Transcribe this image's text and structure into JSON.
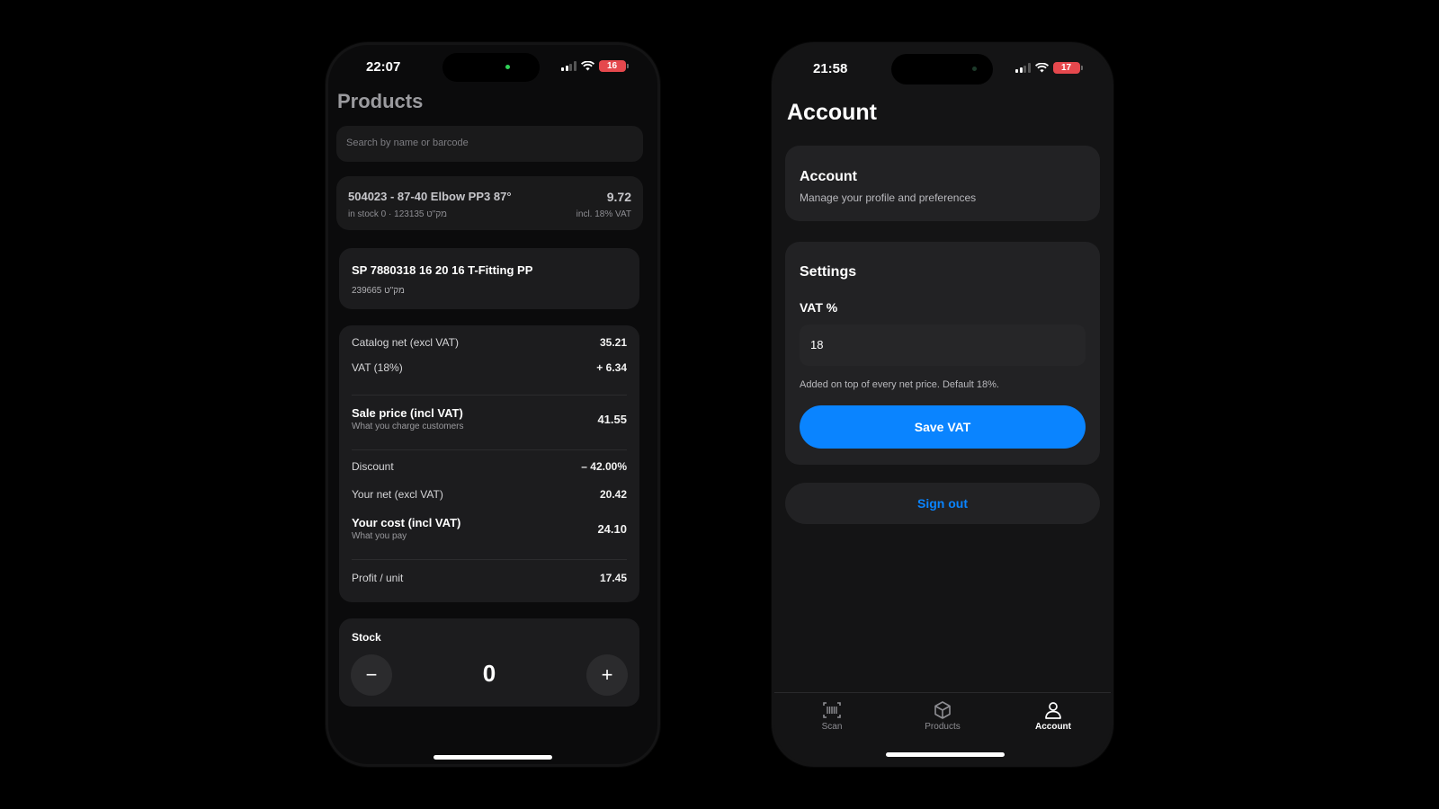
{
  "left_phone": {
    "status": {
      "time": "22:07",
      "battery": "16"
    },
    "title": "Products",
    "search": {
      "placeholder": "Search by name or barcode"
    },
    "product_row": {
      "name": "504023 - 87-40 Elbow PP3 87°",
      "price": "9.72",
      "meta": "in stock 0 · 123135 מק\"ט",
      "vat_note": "incl. 18% VAT"
    },
    "detail": {
      "name": "SP 7880318 16 20 16 T-Fitting PP",
      "sku": "239665 מק\"ט"
    },
    "pricing": {
      "catalog_net_label": "Catalog net (excl VAT)",
      "catalog_net_value": "35.21",
      "vat_label": "VAT (18%)",
      "vat_value": "+ 6.34",
      "sale_label": "Sale price (incl VAT)",
      "sale_sub": "What you charge customers",
      "sale_value": "41.55",
      "discount_label": "Discount",
      "discount_value": "– 42.00%",
      "your_net_label": "Your net (excl VAT)",
      "your_net_value": "20.42",
      "cost_label": "Your cost (incl VAT)",
      "cost_sub": "What you pay",
      "cost_value": "24.10",
      "profit_label": "Profit / unit",
      "profit_value": "17.45"
    },
    "stock": {
      "label": "Stock",
      "value": "0",
      "minus": "−",
      "plus": "+"
    }
  },
  "right_phone": {
    "status": {
      "time": "21:58",
      "battery": "17"
    },
    "title": "Account",
    "account_card": {
      "title": "Account",
      "subtitle": "Manage your profile and preferences"
    },
    "settings": {
      "title": "Settings",
      "vat_label": "VAT %",
      "vat_value": "18",
      "vat_help": "Added on top of every net price. Default 18%.",
      "save_button": "Save VAT"
    },
    "sign_out": "Sign out",
    "tabs": [
      {
        "label": "Scan",
        "icon": "barcode-icon",
        "active": false
      },
      {
        "label": "Products",
        "icon": "box-icon",
        "active": false
      },
      {
        "label": "Account",
        "icon": "person-icon",
        "active": true
      }
    ]
  },
  "colors": {
    "accent": "#0a84ff",
    "card": "#1c1c1e",
    "battery": "#e5484d",
    "island_dot": "#30d158"
  }
}
